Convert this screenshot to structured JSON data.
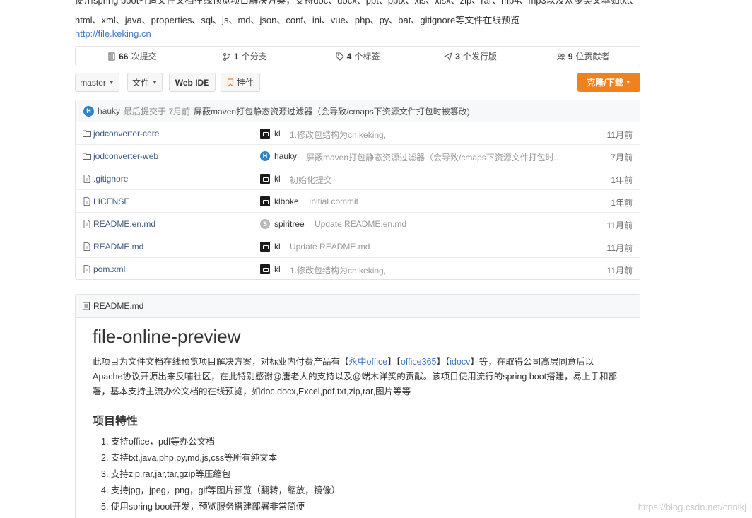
{
  "description": {
    "line1": "使用spring boot打造文件文档在线预览项目解决方案，支持doc、docx、ppt、pptx、xls、xlsx、zip、rar、mp4、mp3以及众多类文本如txt、",
    "line2": "html、xml、java、properties、sql、js、md、json、conf、ini、vue、php、py、bat、gitignore等文件在线预览",
    "link": "http://file.keking.cn"
  },
  "stats": [
    {
      "icon": "commit-book-icon",
      "count": "66",
      "label": "次提交"
    },
    {
      "icon": "branch-icon",
      "count": "1",
      "label": "个分支"
    },
    {
      "icon": "tag-icon",
      "count": "4",
      "label": "个标签"
    },
    {
      "icon": "release-icon",
      "count": "3",
      "label": "个发行版"
    },
    {
      "icon": "contributors-icon",
      "count": "9",
      "label": "位贡献者"
    }
  ],
  "toolbar": {
    "branch": "master",
    "file": "文件",
    "webide": "Web IDE",
    "pin": "挂件",
    "clone": "克隆/下载"
  },
  "colors": {
    "accent": "#f0821e",
    "link": "#4078c0",
    "hauky": "#2f82c7",
    "spiritree": "#b8b8b8"
  },
  "last_commit": {
    "author": "hauky",
    "meta": "最后提交于 7月前",
    "message": "屏蔽maven打包静态资源过滤器（会导致/cmaps下资源文件打包时被篡改)"
  },
  "files": [
    {
      "type": "folder",
      "name": "jodconverter-core",
      "avatar": "dark",
      "author": "kl",
      "message": "1.修改包结构为cn.keking,",
      "time": "11月前"
    },
    {
      "type": "folder",
      "name": "jodconverter-web",
      "avatar": "hauky",
      "author": "hauky",
      "message": "屏蔽maven打包静态资源过滤器（会导致/cmaps下资源文件打包时...",
      "time": "7月前"
    },
    {
      "type": "file",
      "name": ".gitignore",
      "avatar": "dark",
      "author": "kl",
      "message": "初始化提交",
      "time": "1年前"
    },
    {
      "type": "file",
      "name": "LICENSE",
      "avatar": "dark",
      "author": "klboke",
      "message": "Initial commit",
      "time": "1年前"
    },
    {
      "type": "file",
      "name": "README.en.md",
      "avatar": "spiritree",
      "author": "spiritree",
      "message": "Update README.en.md",
      "time": "11月前"
    },
    {
      "type": "file",
      "name": "README.md",
      "avatar": "dark",
      "author": "kl",
      "message": "Update README.md",
      "time": "11月前"
    },
    {
      "type": "file",
      "name": "pom.xml",
      "avatar": "dark",
      "author": "kl",
      "message": "1.修改包结构为cn.keking,",
      "time": "11月前"
    }
  ],
  "readme": {
    "filename": "README.md",
    "title": "file-online-preview",
    "para_a": "此项目为文件文档在线预览项目解决方案，对标业内付费产品有【",
    "link1": "永中office",
    "para_b": "】【",
    "link2": "office365",
    "para_c": "】【",
    "link3": "idocv",
    "para_d": "】等，在取得公司高层同意后以Apache协议开源出来反哺社区，在此特别感谢@唐老大的支持以及@端木详笑的贡献。该项目使用流行的spring boot搭建，易上手和部署，基本支持主流办公文档的在线预览，如doc,docx,Excel,pdf,txt,zip,rar,图片等等",
    "features_title": "项目特性",
    "features": [
      "1. 支持office，pdf等办公文档",
      "2. 支持txt,java,php,py,md,js,css等所有纯文本",
      "3. 支持zip,rar,jar,tar,gzip等压缩包",
      "4. 支持jpg，jpeg，png，gif等图片预览（翻转，缩放，镜像）",
      "5. 使用spring boot开发，预览服务搭建部署非常简便"
    ]
  },
  "watermark": "https://blog.csdn.net/cnnlkj"
}
